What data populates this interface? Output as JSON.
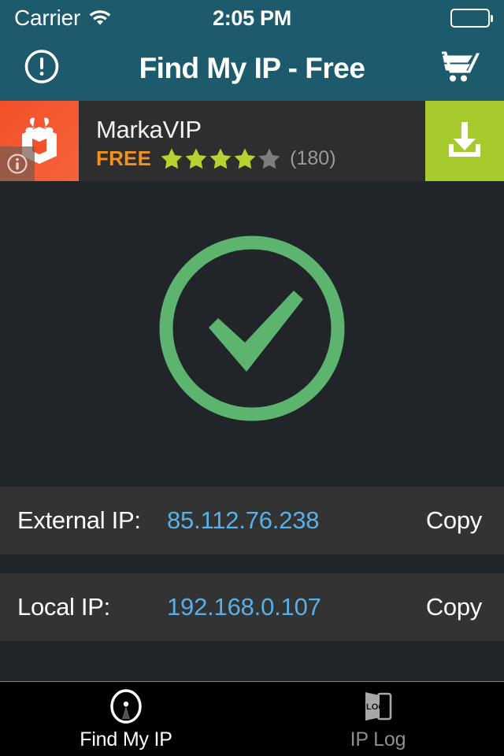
{
  "status_bar": {
    "carrier": "Carrier",
    "wifi_icon": "wifi-icon",
    "time": "2:05 PM",
    "battery_icon": "battery-icon"
  },
  "nav_bar": {
    "title": "Find My IP - Free",
    "left_icon": "exclamation-circle-icon",
    "right_icon": "shopping-cart-icon"
  },
  "ad_banner": {
    "app_icon": "markavip-gift-box-icon",
    "info_badge_icon": "info-icon",
    "app_name": "MarkaVIP",
    "price_label": "FREE",
    "rating": 4,
    "rating_max": 5,
    "review_count": "(180)",
    "download_icon": "download-icon",
    "star_filled_color": "#b5d330",
    "star_empty_color": "#7d7d7d",
    "download_bg_color": "#a6ca2e",
    "free_color": "#f29020"
  },
  "main": {
    "status_icon": "checkmark-circle-icon",
    "status_color": "#5cb46f",
    "rows": [
      {
        "label": "External IP:",
        "value": "85.112.76.238",
        "action": "Copy"
      },
      {
        "label": "Local IP:",
        "value": "192.168.0.107",
        "action": "Copy"
      }
    ],
    "value_color": "#57b0e8"
  },
  "tab_bar": {
    "tabs": [
      {
        "label": "Find My IP",
        "icon": "radar-beacon-icon",
        "active": true
      },
      {
        "label": "IP Log",
        "icon": "log-book-icon",
        "active": false
      }
    ]
  }
}
